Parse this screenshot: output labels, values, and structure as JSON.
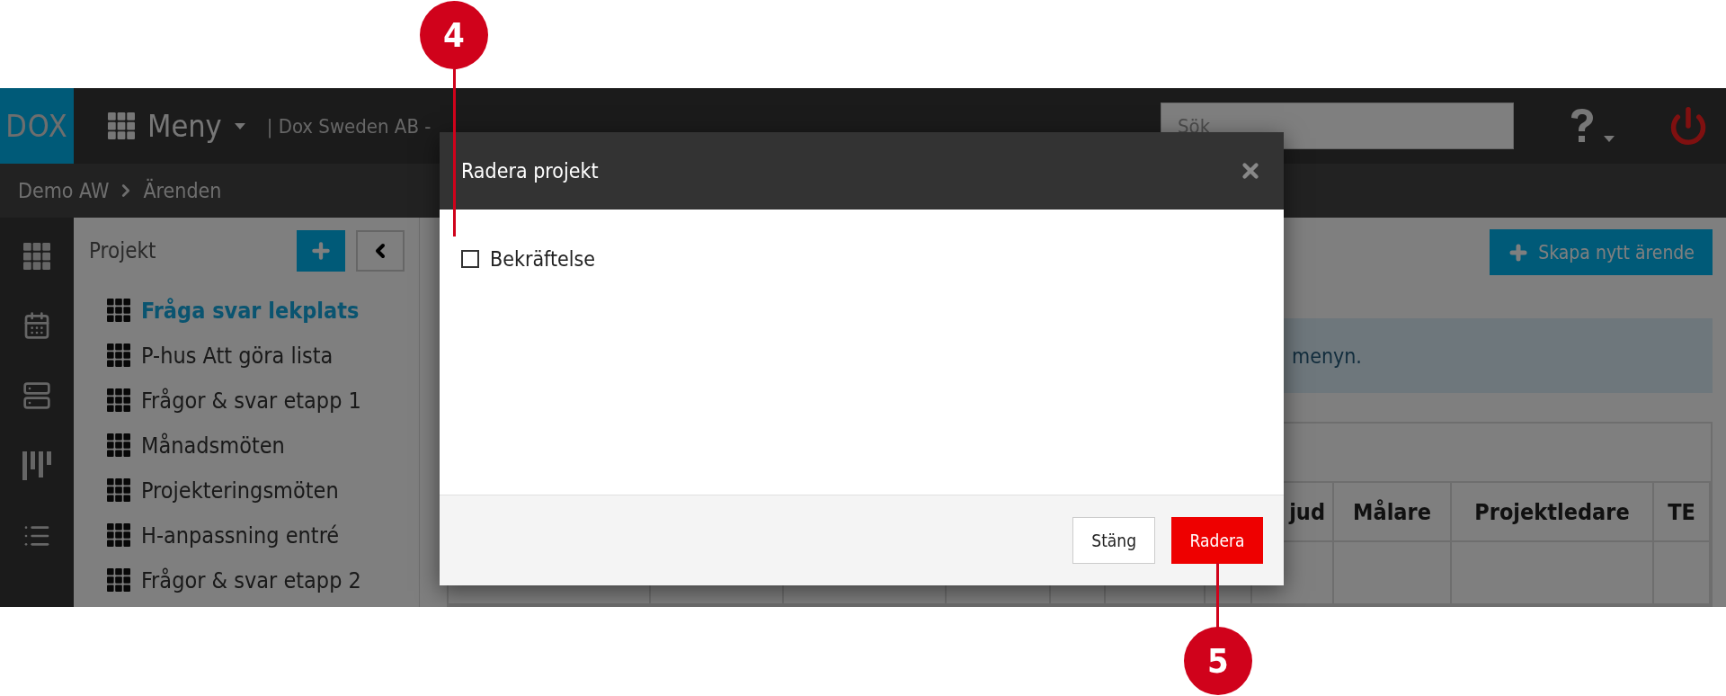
{
  "callouts": [
    {
      "number": "4"
    },
    {
      "number": "5"
    }
  ],
  "header": {
    "logo": "DOX",
    "menu": "Meny",
    "company": "| Dox Sweden AB -",
    "search": {
      "placeholder": "Sök"
    }
  },
  "breadcrumb": [
    "Demo AW",
    "Ärenden"
  ],
  "sidebar": {
    "title": "Projekt",
    "items": [
      {
        "label": "Fråga svar lekplats",
        "selected": true
      },
      {
        "label": "P-hus Att göra lista",
        "selected": false
      },
      {
        "label": "Frågor & svar etapp 1",
        "selected": false
      },
      {
        "label": "Månadsmöten",
        "selected": false
      },
      {
        "label": "Projekteringsmöten",
        "selected": false
      },
      {
        "label": "H-anpassning entré",
        "selected": false
      },
      {
        "label": "Frågor & svar etapp 2",
        "selected": false
      }
    ]
  },
  "main": {
    "create_button": "Skapa nytt ärende",
    "alert": "menyn.",
    "table": {
      "columns": [
        "jud",
        "Målare",
        "Projektledare",
        "TE"
      ]
    }
  },
  "modal": {
    "title": "Radera projekt",
    "checkbox": {
      "label": "Bekräftelse",
      "checked": false
    },
    "buttons": [
      {
        "label": "Stäng",
        "kind": "secondary"
      },
      {
        "label": "Radera",
        "kind": "danger"
      }
    ]
  }
}
